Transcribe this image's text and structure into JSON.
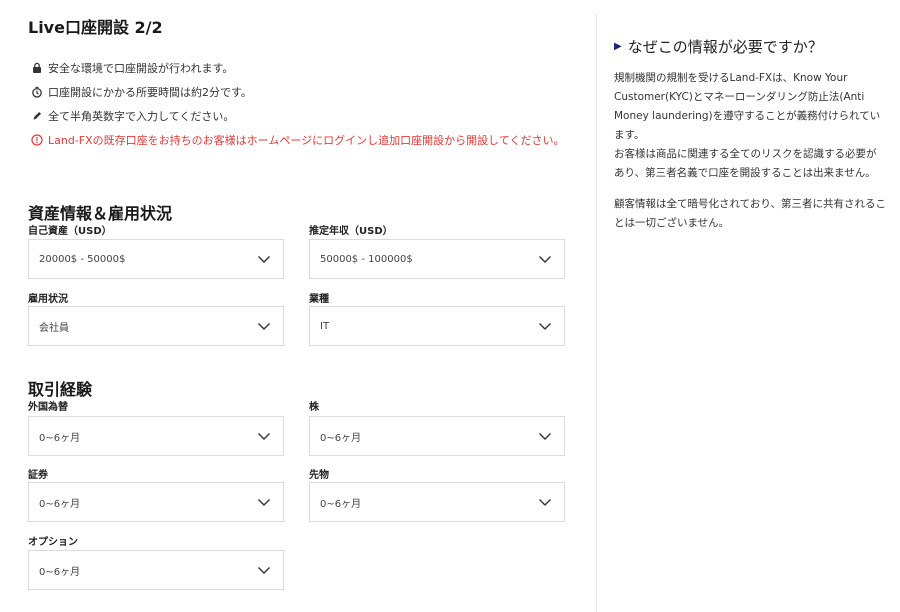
{
  "page": {
    "title": "Live口座開設 2/2"
  },
  "notes": [
    {
      "icon": "lock-icon",
      "text": "安全な環境で口座開設が行われます。"
    },
    {
      "icon": "timer-icon",
      "text": "口座開設にかかる所要時間は約2分です。"
    },
    {
      "icon": "pen-icon",
      "text": "全て半角英数字で入力してください。"
    },
    {
      "icon": "alert-circle-icon",
      "text": "Land-FXの既存口座をお持ちのお客様はホームページにログインし追加口座開設から開設してください。",
      "color": "#e53935"
    }
  ],
  "assets": {
    "title": "資産情報＆雇用状況",
    "fields": [
      {
        "label": "自己資産（USD）",
        "value": "20000$ - 50000$"
      },
      {
        "label": "推定年収（USD）",
        "value": "50000$ - 100000$"
      },
      {
        "label": "雇用状況",
        "value": "会社員"
      },
      {
        "label": "業種",
        "value": "IT"
      }
    ]
  },
  "experience": {
    "title": "取引経験",
    "fields": [
      {
        "label": "外国為替",
        "value": "0~6ヶ月"
      },
      {
        "label": "株",
        "value": "0~6ヶ月"
      },
      {
        "label": "証券",
        "value": "0~6ヶ月"
      },
      {
        "label": "先物",
        "value": "0~6ヶ月"
      },
      {
        "label": "オプション",
        "value": "0~6ヶ月"
      }
    ]
  },
  "sidebar": {
    "title": "なぜこの情報が必要ですか？",
    "paragraphs": [
      "規制機関の規制を受けるLand-FXは、Know Your Customer(KYC)とマネーローンダリング防止法(Anti Money laundering)を遵守することが義務付けられています。\nお客様は商品に関連する全てのリスクを認識する必要があり、第三者名義で口座を開設することは出来ません。",
      "顧客情報は全て暗号化されており、第三者に共有されることは一切ございません。"
    ]
  },
  "colors": {
    "accent_red": "#e53935",
    "triangle": "#1a237e",
    "border": "#dcdcdc"
  }
}
